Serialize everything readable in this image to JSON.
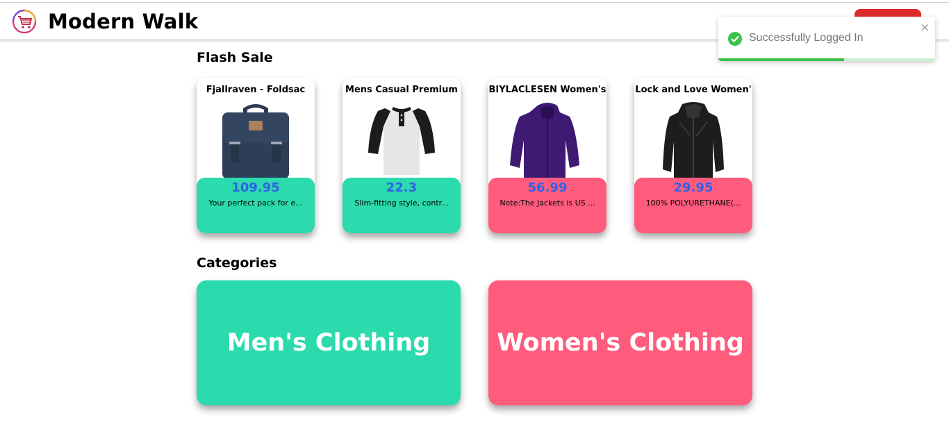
{
  "header": {
    "title": "Modern Walk",
    "logo_icon": "shopping-cart-logo-icon",
    "logout_color": "#e02b2b"
  },
  "flash_sale": {
    "title": "Flash Sale",
    "items": [
      {
        "title": "Fjallraven - Foldsac",
        "price": "109.95",
        "description": "Your perfect pack for e...",
        "theme": "green",
        "image_icon": "backpack-image"
      },
      {
        "title": "Mens Casual Premium",
        "price": "22.3",
        "description": "Slim-fitting style, contr...",
        "theme": "green",
        "image_icon": "raglan-shirt-image"
      },
      {
        "title": "BIYLACLESEN Women's",
        "price": "56.99",
        "description": "Note:The Jackets is US ...",
        "theme": "pink",
        "image_icon": "purple-jacket-image"
      },
      {
        "title": "Lock and Love Women'",
        "price": "29.95",
        "description": "100% POLYURETHANE(...",
        "theme": "pink",
        "image_icon": "leather-jacket-image"
      }
    ]
  },
  "categories": {
    "title": "Categories",
    "items": [
      {
        "label": "Men's Clothing",
        "theme": "green"
      },
      {
        "label": "Women's Clothing",
        "theme": "pink"
      }
    ]
  },
  "toast": {
    "message": "Successfully Logged In",
    "close_symbol": "×",
    "progress": 0.58,
    "icon": "check-circle-icon"
  },
  "colors": {
    "green": "#2bdaad",
    "pink": "#ff5c7d",
    "price": "#2f62e6",
    "success": "#3cc24a"
  }
}
